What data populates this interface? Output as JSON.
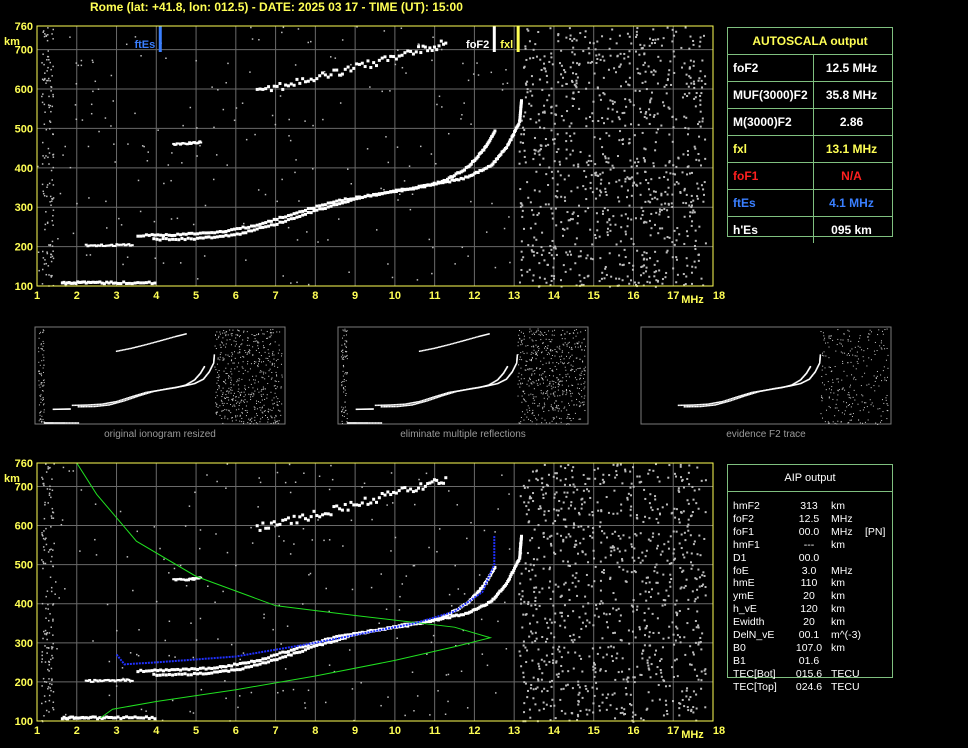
{
  "header": "Rome (lat: +41.8, lon: 012.5) - DATE: 2025 03 17 - TIME (UT): 15:00",
  "chart_data": {
    "type": "scatter",
    "title": "Rome (lat: +41.8, lon: 012.5) - DATE: 2025 03 17 - TIME (UT): 15:00",
    "xlabel": "MHz",
    "ylabel": "km",
    "xlim": [
      1,
      18
    ],
    "ylim": [
      100,
      760
    ],
    "x_ticks": [
      "1",
      "2",
      "3",
      "4",
      "5",
      "6",
      "7",
      "8",
      "9",
      "10",
      "11",
      "12",
      "13",
      "14",
      "15",
      "16",
      "17",
      "18"
    ],
    "y_ticks": [
      "100",
      "200",
      "300",
      "400",
      "500",
      "600",
      "700",
      "760"
    ],
    "grid": true,
    "markers": [
      {
        "label": "ftEs",
        "freq": 4.1,
        "color": "#3a7fff"
      },
      {
        "label": "foF2",
        "freq": 12.5,
        "color": "#ffffff"
      },
      {
        "label": "fxl",
        "freq": 13.1,
        "color": "#ffff55"
      }
    ],
    "traces": {
      "es_low": [
        [
          1.6,
          112
        ],
        [
          2.2,
          112
        ],
        [
          3,
          112
        ],
        [
          4,
          112
        ]
      ],
      "es_mid": [
        [
          2.2,
          205
        ],
        [
          2.8,
          206
        ],
        [
          3.4,
          207
        ]
      ],
      "o_trace": [
        [
          3.5,
          232
        ],
        [
          4.5,
          234
        ],
        [
          5.5,
          240
        ],
        [
          6.5,
          258
        ],
        [
          7.5,
          290
        ],
        [
          8.5,
          320
        ],
        [
          9.5,
          336
        ],
        [
          10.5,
          352
        ],
        [
          11.2,
          370
        ],
        [
          11.8,
          405
        ],
        [
          12.2,
          450
        ],
        [
          12.5,
          500
        ]
      ],
      "x_trace": [
        [
          3.9,
          222
        ],
        [
          5,
          224
        ],
        [
          6,
          235
        ],
        [
          7,
          262
        ],
        [
          8,
          296
        ],
        [
          9,
          326
        ],
        [
          10,
          346
        ],
        [
          11,
          362
        ],
        [
          11.8,
          380
        ],
        [
          12.4,
          410
        ],
        [
          12.8,
          460
        ],
        [
          13.1,
          520
        ],
        [
          13.15,
          580
        ]
      ],
      "f2_echo": [
        [
          6.5,
          600
        ],
        [
          7.5,
          620
        ],
        [
          8.5,
          645
        ],
        [
          9.5,
          672
        ],
        [
          10.5,
          700
        ],
        [
          11.3,
          720
        ]
      ],
      "e_fragment": [
        [
          4.4,
          463
        ],
        [
          4.8,
          465
        ],
        [
          5.1,
          468
        ]
      ]
    },
    "aip_profile": [
      [
        2.6,
        108
      ],
      [
        2.9,
        130
      ],
      [
        4,
        150
      ],
      [
        6,
        180
      ],
      [
        8,
        215
      ],
      [
        10,
        255
      ],
      [
        11.5,
        290
      ],
      [
        12.4,
        313
      ],
      [
        11.5,
        340
      ],
      [
        9,
        370
      ],
      [
        7,
        395
      ],
      [
        5,
        470
      ],
      [
        3.5,
        560
      ],
      [
        2.5,
        680
      ],
      [
        2,
        760
      ]
    ],
    "aip_fit": [
      [
        3,
        270
      ],
      [
        3.2,
        245
      ],
      [
        4,
        250
      ],
      [
        6,
        265
      ],
      [
        8,
        300
      ],
      [
        9.5,
        330
      ],
      [
        10.5,
        350
      ],
      [
        11.5,
        380
      ],
      [
        12.2,
        430
      ],
      [
        12.5,
        500
      ],
      [
        12.5,
        575
      ]
    ]
  },
  "captions": [
    "original ionogram resized",
    "eliminate multiple reflections",
    "evidence F2 trace"
  ],
  "autoscala": {
    "title": "AUTOSCALA output",
    "rows": [
      {
        "name": "foF2",
        "value": "12.5 MHz",
        "color": "#ffffff"
      },
      {
        "name": "MUF(3000)F2",
        "value": "35.8 MHz",
        "color": "#ffffff"
      },
      {
        "name": "M(3000)F2",
        "value": "2.86",
        "color": "#ffffff"
      },
      {
        "name": "fxl",
        "value": "13.1 MHz",
        "color": "#ffff55"
      },
      {
        "name": "foF1",
        "value": "N/A",
        "color": "#ff2020"
      },
      {
        "name": "ftEs",
        "value": "4.1 MHz",
        "color": "#3a7fff"
      },
      {
        "name": "h'Es",
        "value": "095    km",
        "color": "#ffffff"
      }
    ]
  },
  "aip": {
    "title": "AIP output",
    "rows": [
      {
        "name": "hmF2",
        "value": "313",
        "unit": "km",
        "flag": ""
      },
      {
        "name": "foF2",
        "value": "12.5",
        "unit": "MHz",
        "flag": ""
      },
      {
        "name": "foF1",
        "value": "00.0",
        "unit": "MHz",
        "flag": "[PN]"
      },
      {
        "name": "hmF1",
        "value": "---",
        "unit": "km",
        "flag": ""
      },
      {
        "name": "D1",
        "value": "00.0",
        "unit": "",
        "flag": ""
      },
      {
        "name": "foE",
        "value": "3.0",
        "unit": "MHz",
        "flag": ""
      },
      {
        "name": "hmE",
        "value": "110",
        "unit": "km",
        "flag": ""
      },
      {
        "name": "ymE",
        "value": "20",
        "unit": "km",
        "flag": ""
      },
      {
        "name": "h_vE",
        "value": "120",
        "unit": "km",
        "flag": ""
      },
      {
        "name": "Ewidth",
        "value": "20",
        "unit": "km",
        "flag": ""
      },
      {
        "name": "DelN_vE",
        "value": "00.1",
        "unit": "m^(-3)",
        "flag": ""
      },
      {
        "name": "B0",
        "value": "107.0",
        "unit": "km",
        "flag": ""
      },
      {
        "name": "B1",
        "value": "01.6",
        "unit": "",
        "flag": ""
      },
      {
        "name": "TEC[Bot]",
        "value": "015.6",
        "unit": "TECU",
        "flag": ""
      },
      {
        "name": "TEC[Top]",
        "value": "024.6",
        "unit": "TECU",
        "flag": ""
      }
    ]
  }
}
